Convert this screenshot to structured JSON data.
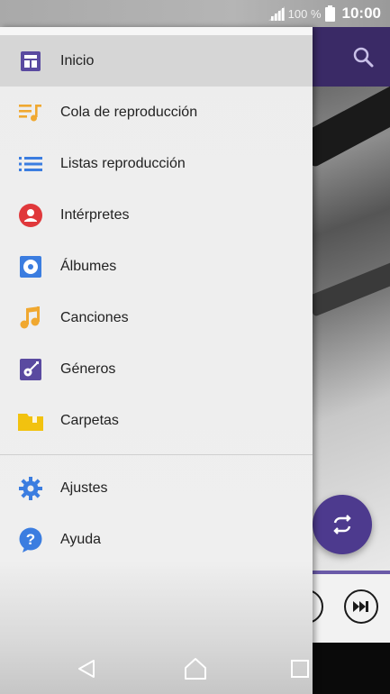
{
  "status_bar": {
    "battery_percent": "100 %",
    "time": "10:00"
  },
  "drawer": {
    "items": [
      {
        "label": "Inicio",
        "icon": "home-dashboard-icon",
        "color": "#5a4aa0",
        "selected": true
      },
      {
        "label": "Cola de reproducción",
        "icon": "queue-music-icon",
        "color": "#f0a830"
      },
      {
        "label": "Listas reproducción",
        "icon": "playlist-icon",
        "color": "#3b7de0"
      },
      {
        "label": "Intérpretes",
        "icon": "artist-icon",
        "color": "#e0383b"
      },
      {
        "label": "Álbumes",
        "icon": "album-icon",
        "color": "#3b7de0"
      },
      {
        "label": "Canciones",
        "icon": "music-note-icon",
        "color": "#f0a830"
      },
      {
        "label": "Géneros",
        "icon": "guitar-icon",
        "color": "#5a4aa0"
      },
      {
        "label": "Carpetas",
        "icon": "folder-icon",
        "color": "#f2c20f"
      }
    ],
    "secondary_items": [
      {
        "label": "Ajustes",
        "icon": "settings-gear-icon",
        "color": "#3b7de0"
      },
      {
        "label": "Ayuda",
        "icon": "help-icon",
        "color": "#3b7de0"
      }
    ]
  },
  "colors": {
    "accent": "#4d3a8e",
    "toolbar": "#3a2a66"
  }
}
